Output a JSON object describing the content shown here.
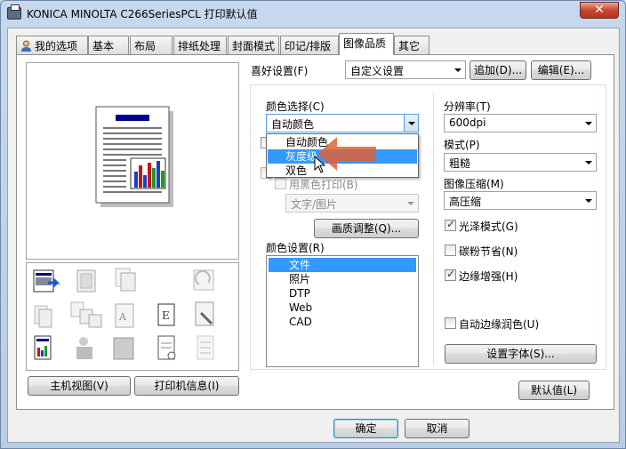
{
  "window": {
    "title": "KONICA MINOLTA C266SeriesPCL 打印默认值",
    "close_glyph": "✕"
  },
  "tabs": [
    {
      "label": "我的选项"
    },
    {
      "label": "基本"
    },
    {
      "label": "布局"
    },
    {
      "label": "排纸处理"
    },
    {
      "label": "封面模式"
    },
    {
      "label": "印记/排版"
    },
    {
      "label": "图像品质"
    },
    {
      "label": "其它"
    }
  ],
  "active_tab": "图像品质",
  "favorites": {
    "label": "喜好设置(F)",
    "value": "自定义设置",
    "add_label": "追加(D)...",
    "edit_label": "编辑(E)..."
  },
  "color_select": {
    "label": "颜色选择(C)",
    "value": "自动颜色",
    "options": [
      "自动颜色",
      "灰度级",
      "双色"
    ],
    "highlighted": "灰度级"
  },
  "black_print": {
    "label": "用黑色打印(B)",
    "checked": false
  },
  "text_image_combo": {
    "value": "文字/图片"
  },
  "quality_adjust_label": "画质调整(Q)...",
  "color_settings": {
    "label": "颜色设置(R)",
    "items": [
      "文件",
      "照片",
      "DTP",
      "Web",
      "CAD"
    ],
    "selected": "文件"
  },
  "resolution": {
    "label": "分辨率(T)",
    "value": "600dpi"
  },
  "mode": {
    "label": "模式(P)",
    "value": "粗糙"
  },
  "compression": {
    "label": "图像压缩(M)",
    "value": "高压缩"
  },
  "options": {
    "gloss": {
      "label": "光泽模式(G)",
      "checked": true
    },
    "toner_save": {
      "label": "碳粉节省(N)",
      "checked": false
    },
    "edge_enhance": {
      "label": "边缘增强(H)",
      "checked": true
    },
    "auto_trapping": {
      "label": "自动边缘润色(U)",
      "checked": false
    }
  },
  "font_settings_label": "设置字体(S)...",
  "default_label": "默认值(L)",
  "host_view_label": "主机视图(V)",
  "printer_info_label": "打印机信息(I)",
  "ok_label": "确定",
  "cancel_label": "取消",
  "colors": {
    "selection": "#3399ff",
    "arrow": "#e0603a"
  }
}
